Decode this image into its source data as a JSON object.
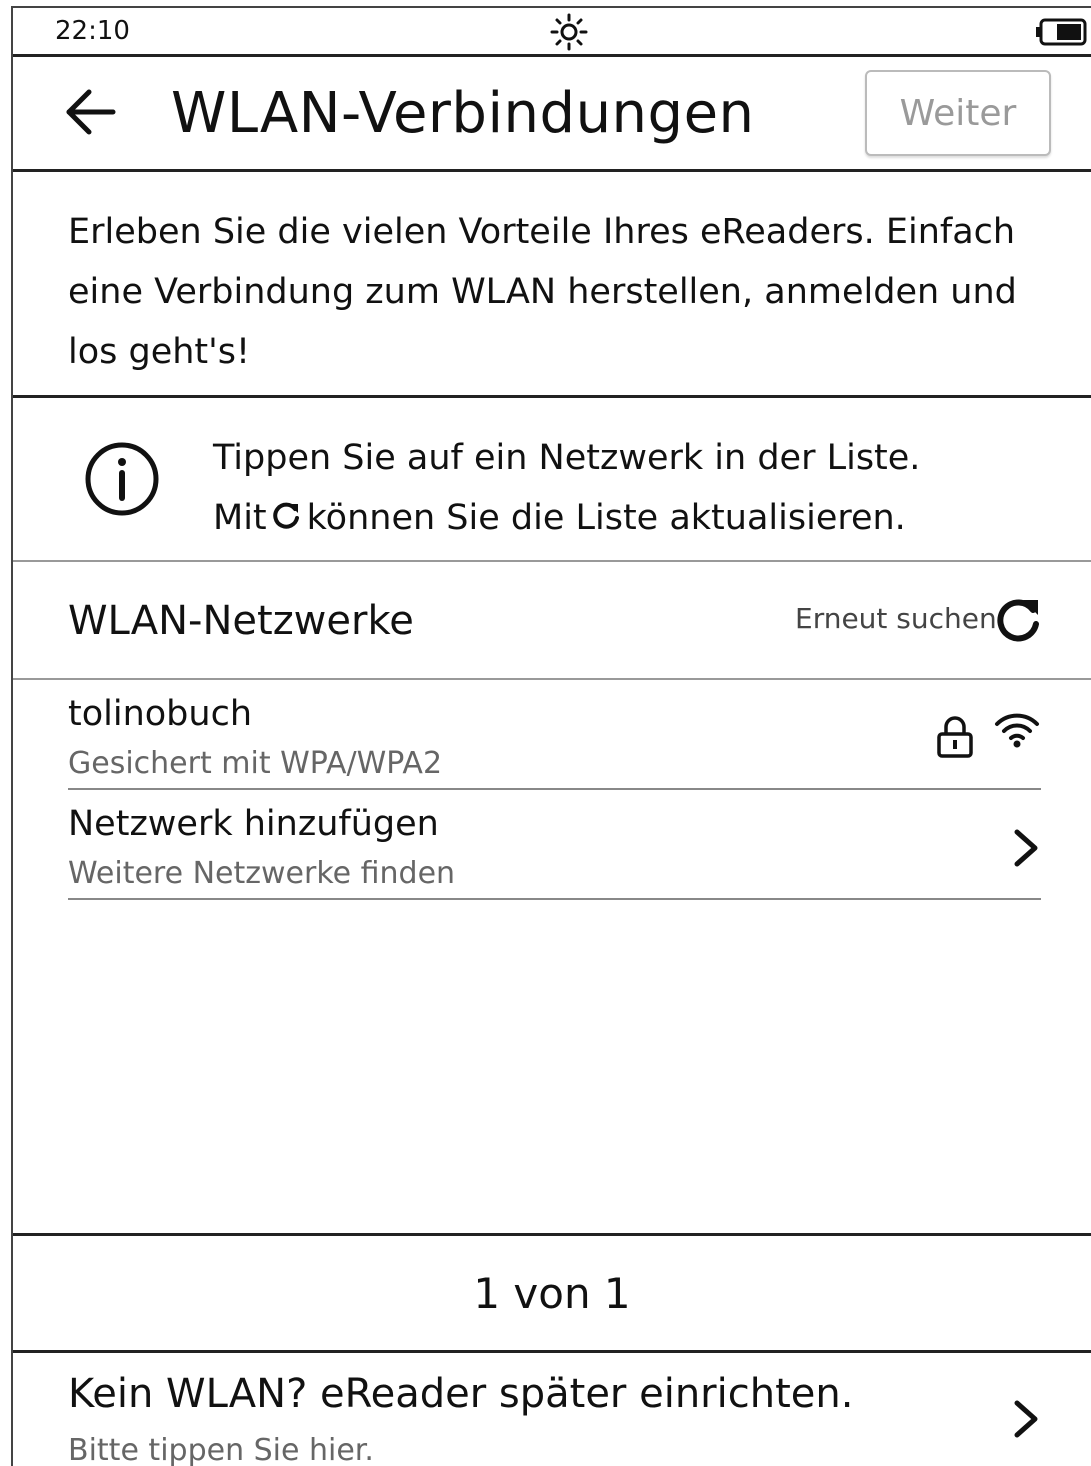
{
  "status_bar": {
    "time": "22:10",
    "light_icon": "sun-icon",
    "battery_icon": "battery-icon"
  },
  "header": {
    "back_icon": "arrow-left-icon",
    "title": "WLAN-Verbindungen",
    "next_label": "Weiter"
  },
  "intro": {
    "text": "Erleben Sie die vielen Vorteile Ihres eReaders. Einfach eine Verbindung zum WLAN herstellen, anmelden und los geht's!"
  },
  "info": {
    "icon": "info-icon",
    "line1": "Tippen Sie auf ein Netzwerk in der Liste.",
    "line2_prefix": "Mit",
    "line2_suffix": "können Sie die Liste aktualisieren."
  },
  "networks": {
    "title": "WLAN-Netzwerke",
    "rescan_label": "Erneut suchen",
    "items": [
      {
        "name": "tolinobuch",
        "security": "Gesichert mit WPA/WPA2",
        "icons": [
          "lock-icon",
          "wifi-icon"
        ]
      }
    ],
    "add_network": {
      "title": "Netzwerk hinzufügen",
      "subtitle": "Weitere Netzwerke finden"
    }
  },
  "pager": {
    "text": "1 von 1"
  },
  "footer": {
    "title": "Kein WLAN? eReader später einrichten.",
    "subtitle": "Bitte tippen Sie hier."
  },
  "colors": {
    "text": "#111111",
    "muted": "#666666",
    "disabled": "#9a9a9a",
    "divider": "#222222"
  }
}
